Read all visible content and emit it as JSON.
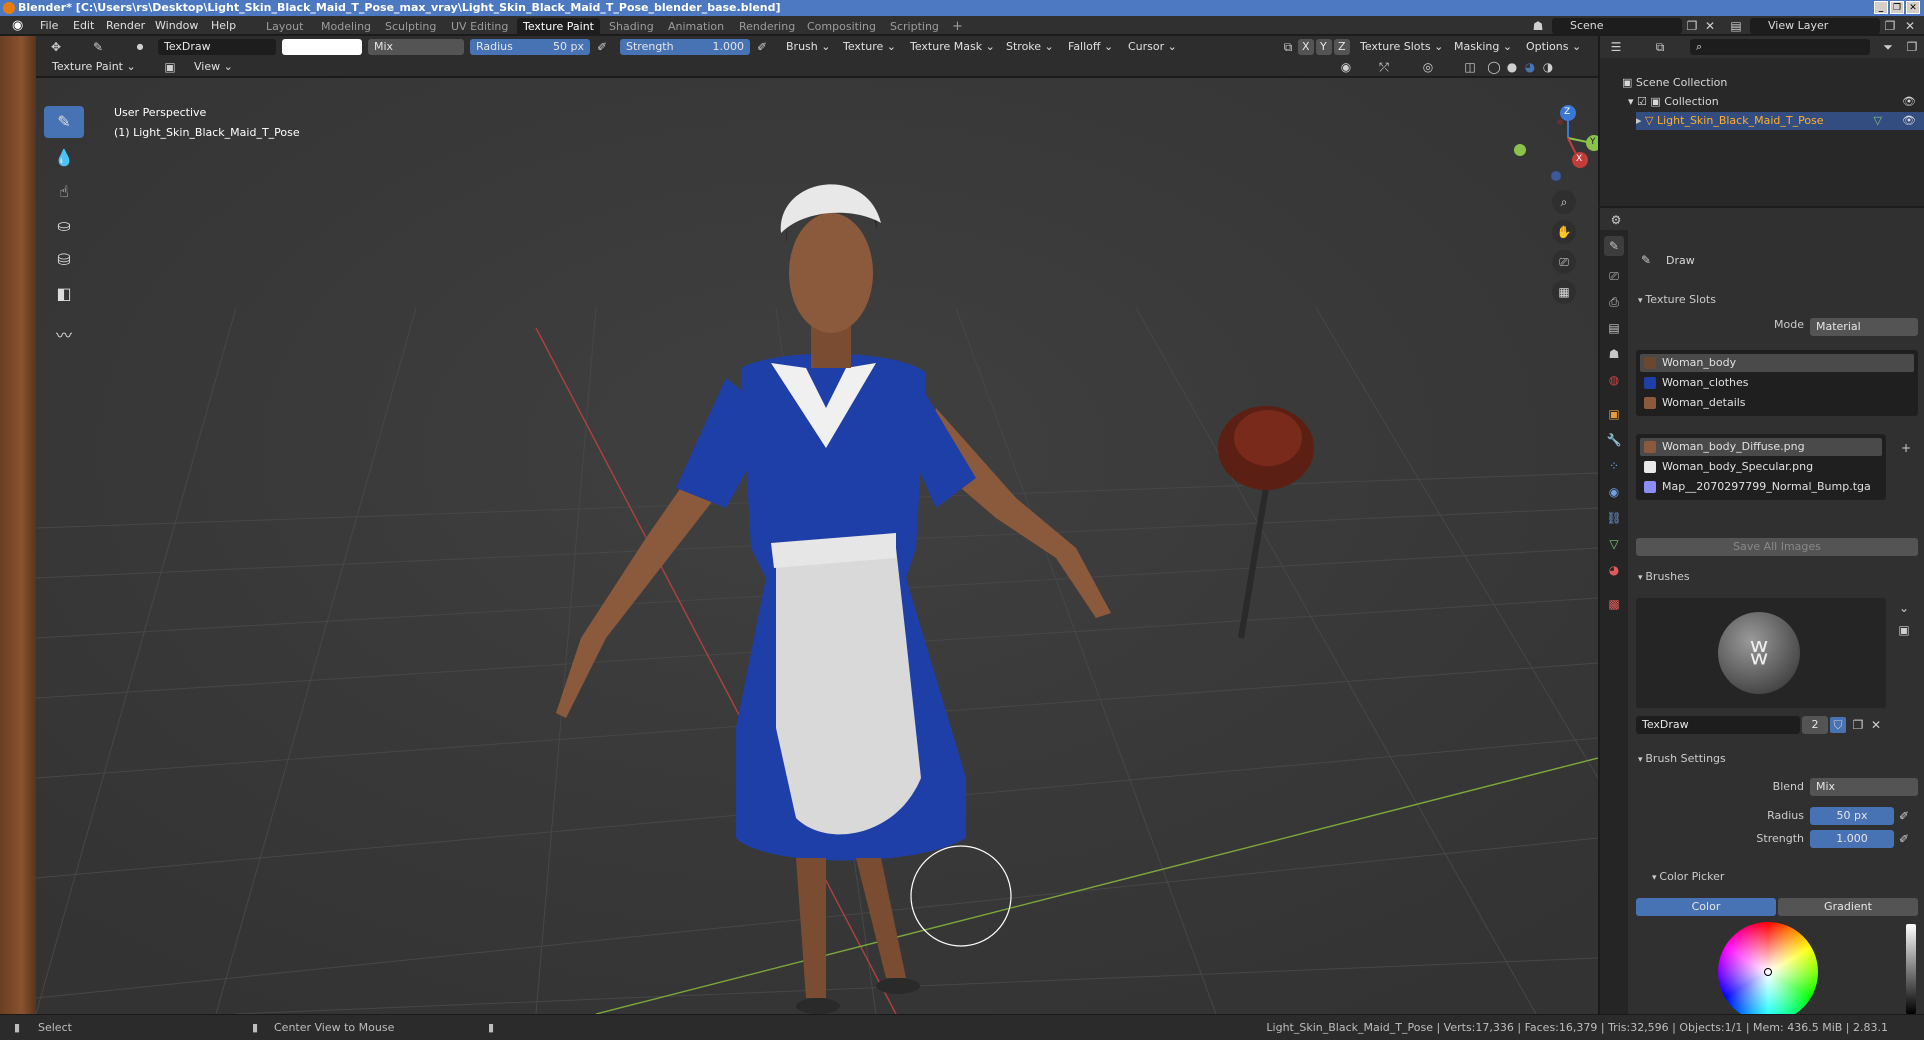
{
  "window": {
    "title": "Blender* [C:\\Users\\rs\\Desktop\\Light_Skin_Black_Maid_T_Pose_max_vray\\Light_Skin_Black_Maid_T_Pose_blender_base.blend]",
    "controls": [
      "_",
      "❐",
      "✕"
    ]
  },
  "menus": [
    "File",
    "Edit",
    "Render",
    "Window",
    "Help"
  ],
  "workspaces": [
    "Layout",
    "Modeling",
    "Sculpting",
    "UV Editing",
    "Texture Paint",
    "Shading",
    "Animation",
    "Rendering",
    "Compositing",
    "Scripting",
    "+"
  ],
  "active_workspace": "Texture Paint",
  "scene": {
    "name": "Scene",
    "view_layer": "View Layer"
  },
  "tool_header": {
    "brush_name": "TexDraw",
    "blend": "Mix",
    "radius_label": "Radius",
    "radius_value": "50 px",
    "strength_label": "Strength",
    "strength_value": "1.000",
    "menus": [
      "Brush",
      "Texture",
      "Texture Mask",
      "Stroke",
      "Falloff",
      "Cursor"
    ],
    "axes": [
      "X",
      "Y",
      "Z"
    ],
    "right_menus": [
      "Texture Slots",
      "Masking",
      "Options"
    ]
  },
  "view_header": {
    "mode": "Texture Paint",
    "view": "View"
  },
  "viewport": {
    "perspective": "User Perspective",
    "object_label": "(1) Light_Skin_Black_Maid_T_Pose",
    "gizmo_axes": [
      "Z",
      "Y",
      "X"
    ]
  },
  "outliner": {
    "root": "Scene Collection",
    "collection": "Collection",
    "object": "Light_Skin_Black_Maid_T_Pose"
  },
  "properties": {
    "tool_name": "Draw",
    "texture_slots": {
      "title": "Texture Slots",
      "mode_label": "Mode",
      "mode_value": "Material",
      "materials": [
        "Woman_body",
        "Woman_clothes",
        "Woman_details"
      ],
      "images": [
        "Woman_body_Diffuse.png",
        "Woman_body_Specular.png",
        "Map__2070297799_Normal_Bump.tga"
      ],
      "save_all": "Save All Images"
    },
    "brushes": {
      "title": "Brushes",
      "name": "TexDraw",
      "users": "2"
    },
    "brush_settings": {
      "title": "Brush Settings",
      "blend_label": "Blend",
      "blend_value": "Mix",
      "radius_label": "Radius",
      "radius_value": "50 px",
      "strength_label": "Strength",
      "strength_value": "1.000"
    },
    "color_picker": {
      "title": "Color Picker",
      "tabs": [
        "Color",
        "Gradient"
      ],
      "active_tab": "Color"
    }
  },
  "statusbar": {
    "left": "Select",
    "middle": "Center View to Mouse",
    "stats": "Light_Skin_Black_Maid_T_Pose | Verts:17,336 | Faces:16,379 | Tris:32,596 | Objects:1/1 | Mem: 436.5 MiB | 2.83.1"
  },
  "colors": {
    "accent": "#4772b3",
    "dress": "#1f3fa8",
    "apron": "#d9d9d9",
    "skin": "#8b5a3c",
    "x_axis": "#c33c3c",
    "y_axis": "#8bc34a",
    "z_axis": "#3a78d6"
  }
}
